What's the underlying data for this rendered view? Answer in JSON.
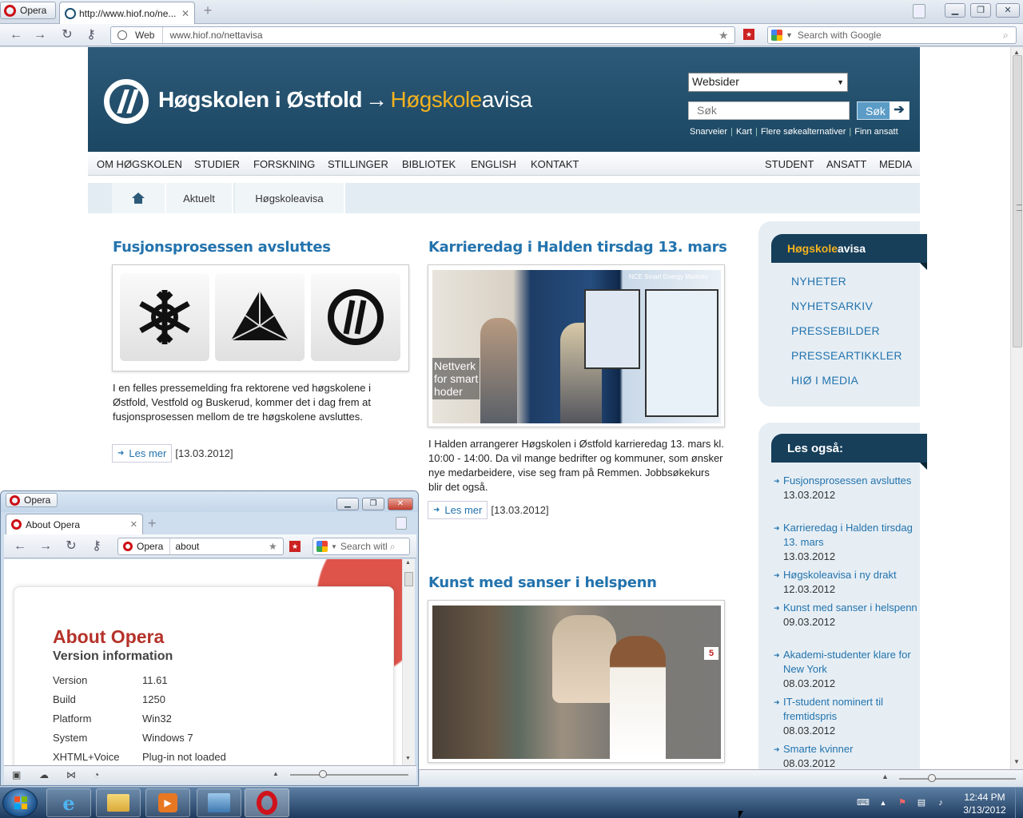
{
  "browser": {
    "menu_label": "Opera",
    "tab_title": "http://www.hiof.no/ne...",
    "address_label": "Web",
    "address_url": "www.hiof.no/nettavisa",
    "search_placeholder": "Search with Google"
  },
  "site": {
    "brand_name": "Høgskolen i Østfold",
    "brand_arrow": "→",
    "brand_sub_1": "Høgskole",
    "brand_sub_2": "avisa",
    "select_value": "Websider",
    "search_placeholder": "Søk",
    "search_button": "Søk",
    "quicklinks": [
      "Snarveier",
      "Kart",
      "Flere søkealternativer",
      "Finn ansatt"
    ],
    "nav_left": [
      "OM HØGSKOLEN",
      "STUDIER",
      "FORSKNING",
      "STILLINGER",
      "BIBLIOTEK",
      "ENGLISH",
      "KONTAKT"
    ],
    "nav_right": [
      "STUDENT",
      "ANSATT",
      "MEDIA"
    ],
    "breadcrumb": [
      "Aktuelt",
      "Høgskoleavisa"
    ]
  },
  "articles": [
    {
      "title": "Fusjonsprosessen avsluttes",
      "body": "I en felles pressemelding fra rektorene ved høgskolene i Østfold, Vestfold og Buskerud, kommer det i dag frem at fusjonsprosessen mellom de tre høgskolene avsluttes.",
      "more": "Les mer",
      "date": "[13.03.2012]"
    },
    {
      "title": "Karrieredag i Halden tirsdag 13. mars",
      "body": "I Halden arrangerer Høgskolen i Østfold karrieredag 13. mars kl. 10:00 - 14:00. Da vil mange bedrifter og kommuner, som ønsker nye medarbeidere, vise seg fram på Remmen. Jobbsøkekurs blir det også.",
      "more": "Les mer",
      "date": "[13.03.2012]",
      "photo_text_1": "Nettverk",
      "photo_text_2": "for smart",
      "photo_text_3": "hoder",
      "photo_banner": "NCE Smart Energy Markets"
    },
    {
      "title": "Kunst med sanser i helspenn",
      "photo_badge": "5"
    }
  ],
  "sidebar": {
    "box1_title_1": "Høgskole",
    "box1_title_2": "avisa",
    "links": [
      "NYHETER",
      "NYHETSARKIV",
      "PRESSEBILDER",
      "PRESSEARTIKKLER",
      "HIØ I MEDIA"
    ],
    "box2_title": "Les også:",
    "les_ogsa": [
      {
        "t": "Fusjonsprosessen avsluttes",
        "d": "13.03.2012"
      },
      {
        "t": "Karrieredag i Halden tirsdag 13. mars",
        "d": "13.03.2012"
      },
      {
        "t": "Høgskoleavisa i ny drakt",
        "d": "12.03.2012"
      },
      {
        "t": "Kunst med sanser i helspenn",
        "d": "09.03.2012"
      },
      {
        "t": "Akademi-studenter klare for New York",
        "d": "08.03.2012"
      },
      {
        "t": "IT-student nominert til fremtidspris",
        "d": "08.03.2012"
      },
      {
        "t": "Smarte kvinner",
        "d": "08.03.2012"
      }
    ]
  },
  "about_window": {
    "app_name": "Opera",
    "tab_title": "About Opera",
    "address_label": "Opera",
    "address_value": "about",
    "search_placeholder": "Search with Google",
    "heading": "About Opera",
    "subheading": "Version information",
    "rows": [
      {
        "k": "Version",
        "v": "11.61"
      },
      {
        "k": "Build",
        "v": "1250"
      },
      {
        "k": "Platform",
        "v": "Win32"
      },
      {
        "k": "System",
        "v": "Windows 7"
      },
      {
        "k": "XHTML+Voice",
        "v": "Plug-in not loaded"
      }
    ]
  },
  "taskbar": {
    "time": "12:44 PM",
    "date": "3/13/2012"
  },
  "colors": {
    "banner": "#1b4763",
    "link_blue": "#2373ad",
    "accent_gold": "#f2b21f",
    "opera_red": "#cc0f16"
  }
}
